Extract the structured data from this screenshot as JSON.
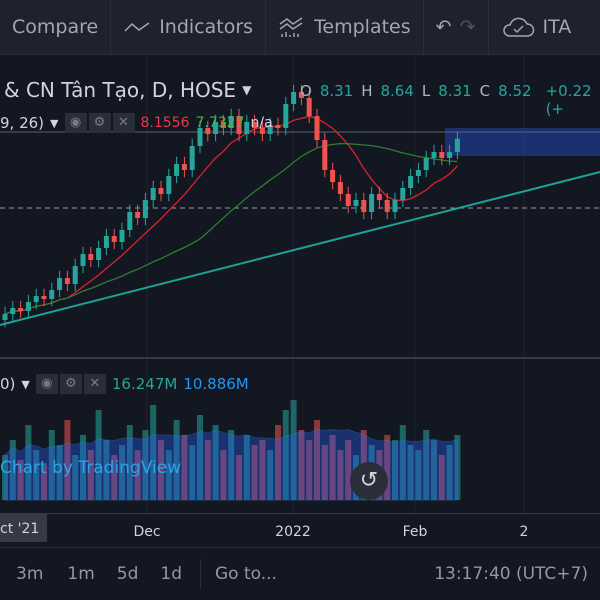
{
  "toolbar": {
    "compare": "Compare",
    "indicators": "Indicators",
    "templates": "Templates",
    "layout": "ITA"
  },
  "legend": {
    "symbol": "& CN Tân Tạo, D, HOSE",
    "o_label": "O",
    "o": "8.31",
    "h_label": "H",
    "h": "8.64",
    "l_label": "L",
    "l": "8.31",
    "c_label": "C",
    "c": "8.52",
    "change": "+0.22 (+"
  },
  "indicator": {
    "params": "9, 26)",
    "v1": "8.1556",
    "v2": "7.7327",
    "v3": "n/a"
  },
  "volume": {
    "params": "0)",
    "v1": "16.247M",
    "v2": "10.886M"
  },
  "watermark": "Chart by TradingView",
  "time_axis": {
    "current": "ct '21",
    "labels": [
      "Dec",
      "2022",
      "Feb",
      "2"
    ]
  },
  "bottom": {
    "ranges": [
      "3m",
      "1m",
      "5d",
      "1d"
    ],
    "goto": "Go to...",
    "clock": "13:17:40 (UTC+7)"
  },
  "colors": {
    "up": "#26a69a",
    "down": "#ef5350",
    "ma_fast": "#e0202f",
    "ma_slow": "#2e7d32",
    "trend": "#1ca395",
    "volume_area": "#2962ff"
  },
  "chart_data": {
    "type": "candlestick",
    "closes": [
      5.6,
      5.7,
      5.65,
      5.8,
      5.9,
      5.85,
      6.0,
      6.2,
      6.1,
      6.4,
      6.6,
      6.5,
      6.7,
      6.9,
      6.8,
      7.0,
      7.3,
      7.2,
      7.5,
      7.7,
      7.6,
      7.9,
      8.1,
      8.0,
      8.4,
      8.7,
      8.6,
      8.8,
      8.7,
      8.9,
      8.6,
      8.8,
      8.7,
      8.6,
      8.75,
      8.7,
      9.1,
      9.3,
      9.2,
      8.9,
      8.5,
      8.0,
      7.8,
      7.6,
      7.4,
      7.5,
      7.3,
      7.6,
      7.5,
      7.3,
      7.5,
      7.7,
      7.9,
      8.0,
      8.2,
      8.3,
      8.2,
      8.3,
      8.52
    ],
    "volumes": [
      9,
      12,
      8,
      15,
      10,
      7,
      14,
      11,
      16,
      9,
      13,
      10,
      18,
      12,
      9,
      11,
      15,
      10,
      14,
      19,
      12,
      10,
      16,
      13,
      11,
      17,
      12,
      15,
      10,
      14,
      9,
      13,
      11,
      12,
      10,
      15,
      18,
      20,
      14,
      12,
      16,
      11,
      13,
      10,
      12,
      9,
      14,
      11,
      10,
      13,
      12,
      15,
      11,
      10,
      14,
      12,
      9,
      11,
      13
    ],
    "dashed_level": 7.5
  }
}
